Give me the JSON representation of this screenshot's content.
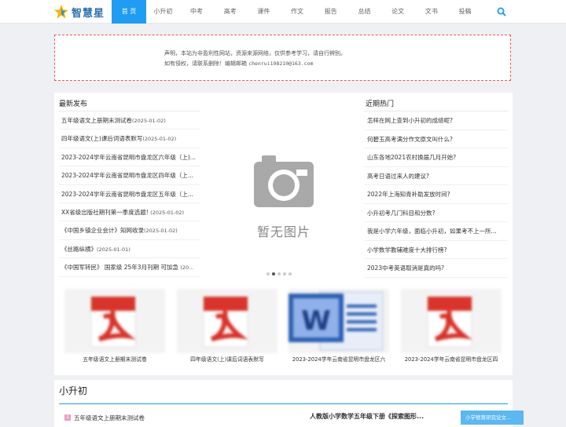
{
  "brand": {
    "name": "智慧星"
  },
  "nav": [
    "首 页",
    "小升初",
    "中考",
    "高考",
    "课件",
    "作文",
    "报告",
    "总结",
    "论文",
    "文书",
    "投稿"
  ],
  "notice": {
    "line1": "声明，本站为非盈利性网站，资源来源网络，仅供参考学习，请自行辨别。",
    "line2_text": "如有侵权，请联系删除！编辑邮箱 ",
    "line2_email": "chenrui198210@163.com"
  },
  "latest": {
    "title": "最新发布",
    "items": [
      {
        "text": "五年级语文上册期末测试卷",
        "date": "(2025-01-02)"
      },
      {
        "text": "四年级语文(上)课后词语表默写",
        "date": "(2025-01-02)"
      },
      {
        "text": "2023-2024学年云南省昆明市盘龙区六年级（上)...",
        "date": ""
      },
      {
        "text": "2023-2024学年云南省昆明市盘龙区四年级（上...",
        "date": ""
      },
      {
        "text": "2023-2024学年云南省昆明市盘龙区五年级（上...",
        "date": ""
      },
      {
        "text": "XX省级出版社期刊第一季度选题! ",
        "date": "(2025-01-02)"
      },
      {
        "text": "《中国乡镇企业会计》知网收录",
        "date": "(2025-01-02)"
      },
      {
        "text": "《丝路纵横》",
        "date": "(2025-01-01)"
      },
      {
        "text": "《中国军转民》 国家级 25年3月刊期 可加急 ",
        "date": "(20..."
      }
    ]
  },
  "hot": {
    "title": "近期热门",
    "items": [
      "怎样在网上查到小升初的成绩呢?",
      "何碧玉高考满分作文原文叫什么?",
      "山东各地2021农村换届几月开始?",
      "高考日语过来人的建议?",
      "2022年上海知青补助发放时间?",
      "小升初考几门科目和分数?",
      "我是小学六年级，面临小升初，如果考不上一所...",
      "小学数学教辅难度十大排行榜?",
      "2023中考英语取消是真的吗?"
    ]
  },
  "slider": {
    "placeholder": "暂无图片",
    "dot_count": 5,
    "active_dot": 1
  },
  "thumbs": [
    {
      "icon": "pdf-icon",
      "caption": "五年级语文上册期末测试卷"
    },
    {
      "icon": "pdf-icon",
      "caption": "四年级语文(上)课后词语表默写"
    },
    {
      "icon": "word-icon",
      "caption": "2023-2024学年云南省昆明市盘龙区六"
    },
    {
      "icon": "pdf-icon",
      "caption": "2023-2024学年云南省昆明市盘龙区四"
    }
  ],
  "section": {
    "title": "小升初",
    "badge": "1",
    "first_item": "五年级语文上册期末测试卷",
    "feature_title": "人教版小学数学五年级下册《探索图形...",
    "button_label": "小学德育研究论文..."
  },
  "colors": {
    "accent": "#1e9df2",
    "notice_border": "#e55555",
    "pdf_red": "#d9342b",
    "word_blue": "#2b5fb4"
  }
}
